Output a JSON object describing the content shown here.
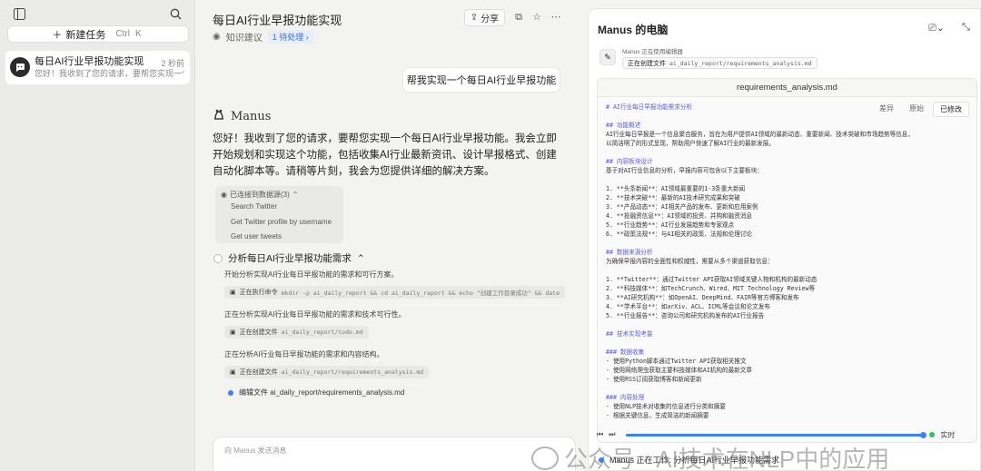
{
  "sidebar": {
    "new_task_label": "新建任务",
    "shortcut_ctrl": "Ctrl",
    "shortcut_key": "K",
    "task": {
      "title": "每日AI行业早报功能实现",
      "time": "2 秒前",
      "preview": "您好！我收到了您的请求，要帮您实现一个..."
    }
  },
  "main": {
    "title": "每日AI行业早报功能实现",
    "meta_label": "知识建议",
    "pending_badge": "1 待处理 ›",
    "share_label": "分享",
    "user_message": "帮我实现一个每日AI行业早报功能",
    "agent_name": "Manus",
    "reply": "您好！我收到了您的请求，要帮您实现一个每日AI行业早报功能。我会立即开始规划和实现这个功能，包括收集AI行业最新资讯、设计早报格式、创建自动化脚本等。请稍等片刻，我会为您提供详细的解决方案。",
    "datasource": {
      "header": "已连接到数据源(3)",
      "items": [
        "Search Twitter",
        "Get Twitter profile by username",
        "Get user tweets"
      ]
    },
    "step": {
      "title": "分析每日AI行业早报功能需求",
      "lines": [
        "开始分析实现AI行业每日早报功能的需求和可行方案。",
        "正在分析实现AI行业每日早报功能的需求和技术可行性。",
        "正在分析AI行业每日早报功能的需求和内容结构。"
      ],
      "cmd1_label": "正在执行命令",
      "cmd1_text": "mkdir -p ai_daily_report && cd ai_daily_report && echo \"创建工作目录成功\" && date",
      "cmd2_label": "正在创建文件",
      "cmd2_text": "ai_daily_report/todo.md",
      "cmd3_label": "正在创建文件",
      "cmd3_text": "ai_daily_report/requirements_analysis.md",
      "current": "编辑文件 ai_daily_report/requirements_analysis.md"
    },
    "input_placeholder": "向 Manus 发送消息"
  },
  "panel": {
    "title": "Manus 的电脑",
    "using": "Manus 正在使用编辑器",
    "action_label": "正在创建文件",
    "action_path": "ai_daily_report/requirements_analysis.md",
    "file_name": "requirements_analysis.md",
    "tabs": [
      "差异",
      "原始",
      "已修改"
    ],
    "live_label": "实时",
    "progress": 1.0
  },
  "editor_lines": [
    {
      "t": "# AI行业每日早报功能需求分析",
      "c": "h"
    },
    {
      "t": "",
      "c": ""
    },
    {
      "t": "## 功能概述",
      "c": "h"
    },
    {
      "t": "AI行业每日早报是一个信息聚合服务，旨在为用户提供AI领域的最新动态、重要新闻、技术突破和市场趋势等信息，",
      "c": ""
    },
    {
      "t": "以简洁明了的形式呈现，帮助用户快速了解AI行业的最新发展。",
      "c": ""
    },
    {
      "t": "",
      "c": ""
    },
    {
      "t": "## 内容板块设计",
      "c": "h"
    },
    {
      "t": "基于对AI行业信息的分析，早报内容可包含以下主要板块：",
      "c": ""
    },
    {
      "t": "",
      "c": ""
    },
    {
      "t": "1. **头条新闻**：AI领域最重要的1-3条重大新闻",
      "c": "n"
    },
    {
      "t": "2. **技术突破**：最新的AI技术研究成果和突破",
      "c": "n"
    },
    {
      "t": "3. **产品动态**：AI相关产品的发布、更新和应用案例",
      "c": "n"
    },
    {
      "t": "4. **投融资信息**：AI领域的投资、并购和融资消息",
      "c": "n"
    },
    {
      "t": "5. **行业趋势**：AI行业发展趋势和专家观点",
      "c": "n"
    },
    {
      "t": "6. **政策法规**：与AI相关的政策、法规和伦理讨论",
      "c": "n"
    },
    {
      "t": "",
      "c": ""
    },
    {
      "t": "## 数据来源分析",
      "c": "h"
    },
    {
      "t": "为确保早报内容的全面性和权威性，需要从多个渠道获取信息：",
      "c": ""
    },
    {
      "t": "",
      "c": ""
    },
    {
      "t": "1. **Twitter**：通过Twitter API获取AI领域关键人物和机构的最新动态",
      "c": "n"
    },
    {
      "t": "2. **科技媒体**：如TechCrunch、Wired、MIT Technology Review等",
      "c": "n"
    },
    {
      "t": "3. **AI研究机构**：如OpenAI、DeepMind、FAIR等官方博客和发布",
      "c": "n"
    },
    {
      "t": "4. **学术平台**：如arXiv、ACL、ICML等会议和论文发布",
      "c": "n"
    },
    {
      "t": "5. **行业报告**：咨询公司和研究机构发布的AI行业报告",
      "c": "n"
    },
    {
      "t": "",
      "c": ""
    },
    {
      "t": "## 技术实现考量",
      "c": "h"
    },
    {
      "t": "",
      "c": ""
    },
    {
      "t": "### 数据收集",
      "c": "h"
    },
    {
      "t": "- 使用Python脚本通过Twitter API获取相关推文",
      "c": ""
    },
    {
      "t": "- 使用网络爬虫获取主要科技媒体和AI机构的最新文章",
      "c": ""
    },
    {
      "t": "- 使用RSS订阅获取博客和新闻更新",
      "c": ""
    },
    {
      "t": "",
      "c": ""
    },
    {
      "t": "### 内容处理",
      "c": "h"
    },
    {
      "t": "- 使用NLP技术对收集的信息进行分类和摘要",
      "c": ""
    },
    {
      "t": "- 根据关键信息，生成简洁的新闻摘要",
      "c": ""
    }
  ],
  "bottom": {
    "status": "Manus 正在工作: 分析每日AI行业早报功能需求"
  },
  "watermark": "公众号 · AI技术在NLP中的应用"
}
